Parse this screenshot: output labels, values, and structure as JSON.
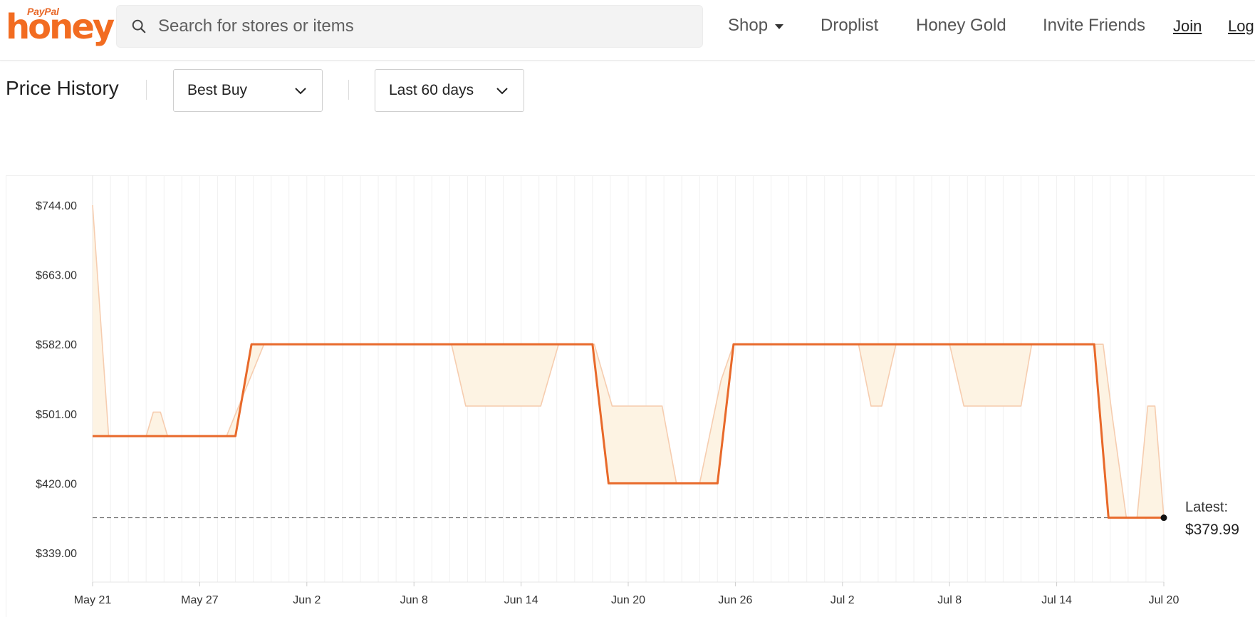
{
  "header": {
    "logo_brand": "PayPal",
    "logo_name": "honey",
    "search_placeholder": "Search for stores or items",
    "nav": {
      "shop": "Shop",
      "droplist": "Droplist",
      "honey_gold": "Honey Gold",
      "invite": "Invite Friends",
      "join": "Join",
      "login": "Log"
    }
  },
  "price_history": {
    "title": "Price History",
    "store_select": "Best Buy",
    "range_select": "Last 60 days",
    "latest_label": "Latest:",
    "latest_value": "$379.99"
  },
  "colors": {
    "accent": "#e8692a",
    "fill": "#fdf3e3",
    "fill_stroke": "#f6cdb0",
    "grid": "#f1f1f1"
  },
  "chart_data": {
    "type": "line",
    "title": "",
    "xlabel": "",
    "ylabel": "",
    "y_ticks": [
      "$744.00",
      "$663.00",
      "$582.00",
      "$501.00",
      "$420.00",
      "$339.00"
    ],
    "y_tick_values": [
      744,
      663,
      582,
      501,
      420,
      339
    ],
    "ylim": [
      305,
      744
    ],
    "x_ticks": [
      "May 21",
      "May 27",
      "Jun 2",
      "Jun 8",
      "Jun 14",
      "Jun 20",
      "Jun 26",
      "Jul 2",
      "Jul 8",
      "Jul 14",
      "Jul 20"
    ],
    "x_tick_days": [
      0,
      6,
      12,
      18,
      24,
      30,
      36,
      42,
      48,
      54,
      60
    ],
    "xlim": [
      0,
      60
    ],
    "series": [
      {
        "role": "price",
        "points": [
          [
            0,
            475
          ],
          [
            8,
            475
          ],
          [
            8.9,
            582
          ],
          [
            28,
            582
          ],
          [
            28.9,
            420
          ],
          [
            35,
            420
          ],
          [
            35.9,
            582
          ],
          [
            56.1,
            582
          ],
          [
            56.9,
            379.99
          ],
          [
            60,
            379.99
          ]
        ]
      }
    ],
    "range_band": {
      "upper": [
        [
          0,
          744
        ],
        [
          0.9,
          475
        ],
        [
          3,
          475
        ],
        [
          3.4,
          503
        ],
        [
          3.8,
          503
        ],
        [
          4.2,
          475
        ],
        [
          7.5,
          475
        ],
        [
          9.6,
          582
        ],
        [
          20.1,
          582
        ],
        [
          20.9,
          510
        ],
        [
          25.1,
          510
        ],
        [
          26.1,
          582
        ],
        [
          28.1,
          582
        ],
        [
          29.1,
          510
        ],
        [
          31.9,
          510
        ],
        [
          32.7,
          420
        ],
        [
          34,
          420
        ],
        [
          35.2,
          540
        ],
        [
          35.9,
          582
        ],
        [
          42.9,
          582
        ],
        [
          43.6,
          510
        ],
        [
          44.2,
          510
        ],
        [
          45,
          582
        ],
        [
          48,
          582
        ],
        [
          48.8,
          510
        ],
        [
          52,
          510
        ],
        [
          52.6,
          582
        ],
        [
          56.6,
          582
        ],
        [
          57.1,
          500
        ],
        [
          57.9,
          379.99
        ],
        [
          58.5,
          379.99
        ],
        [
          59.1,
          510
        ],
        [
          59.5,
          510
        ],
        [
          60,
          379.99
        ]
      ],
      "lower": [
        [
          0,
          475
        ],
        [
          8,
          475
        ],
        [
          8.9,
          582
        ],
        [
          28,
          582
        ],
        [
          28.9,
          420
        ],
        [
          35,
          420
        ],
        [
          35.9,
          582
        ],
        [
          56.1,
          582
        ],
        [
          56.9,
          379.99
        ],
        [
          60,
          379.99
        ]
      ]
    },
    "latest": {
      "x": 60,
      "y": 379.99
    },
    "grid": true
  }
}
